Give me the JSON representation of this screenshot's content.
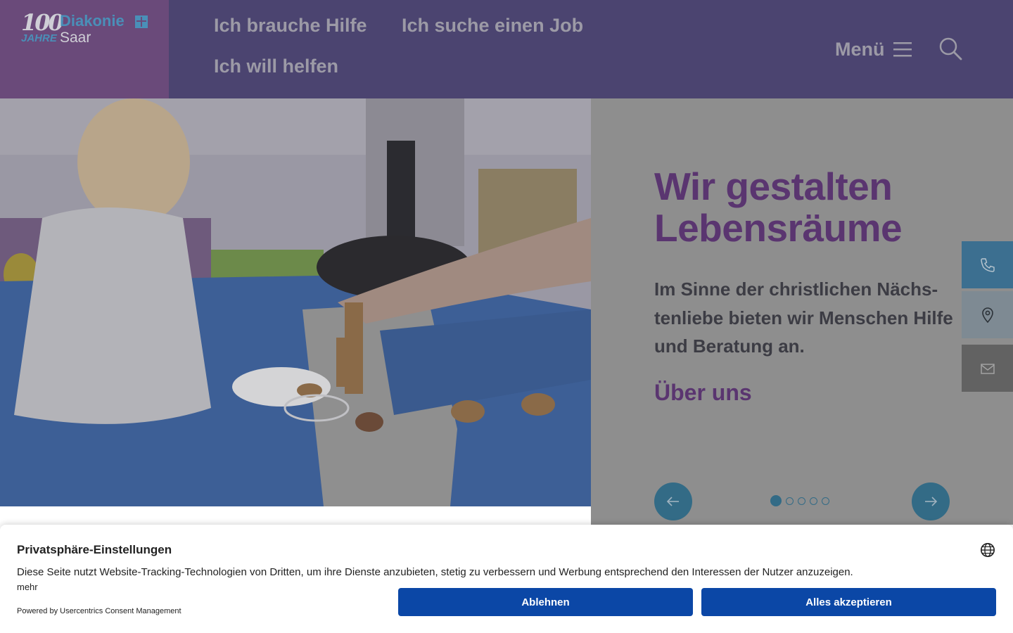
{
  "header": {
    "logo": {
      "years": "100",
      "jahre": "JAHRE",
      "brand": "Diakonie",
      "region": "Saar"
    },
    "nav": [
      {
        "label": "Ich brauche Hilfe"
      },
      {
        "label": "Ich suche einen Job"
      },
      {
        "label": "Ich will helfen"
      }
    ],
    "menu_label": "Menü",
    "menu_icon": "hamburger-icon",
    "search_icon": "search-icon"
  },
  "hero": {
    "photo": "child-playing-with-corks",
    "title": "Wir gestalten Lebensräume",
    "text": "Im Sinne der christlichen Nächs­tenliebe bieten wir Menschen Hilfe und Beratung an.",
    "link_label": "Über uns",
    "slider": {
      "current": 1,
      "total": 5
    },
    "prev_icon": "arrow-left-icon",
    "next_icon": "arrow-right-icon"
  },
  "side_contact": [
    {
      "icon": "phone-icon"
    },
    {
      "icon": "location-pin-icon"
    },
    {
      "icon": "mail-icon"
    }
  ],
  "consent": {
    "title": "Privatsphäre-Einstellungen",
    "text": "Diese Seite nutzt Website-Tracking-Technologien von Dritten, um ihre Dienste anzubieten, stetig zu verbessern und Werbung entsprechend den Interessen der Nutzer anzuzeigen.",
    "more": "mehr",
    "powered_by": "Powered by Usercentrics Consent Management",
    "deny_label": "Ablehnen",
    "accept_label": "Alles akzeptieren",
    "language_icon": "globe-icon"
  },
  "colors": {
    "header_bg": "#4b4470",
    "logo_bg": "#6a4a7a",
    "title_purple": "#5a3570",
    "slider_blue": "#336b86",
    "button_blue": "#0b47a6"
  }
}
